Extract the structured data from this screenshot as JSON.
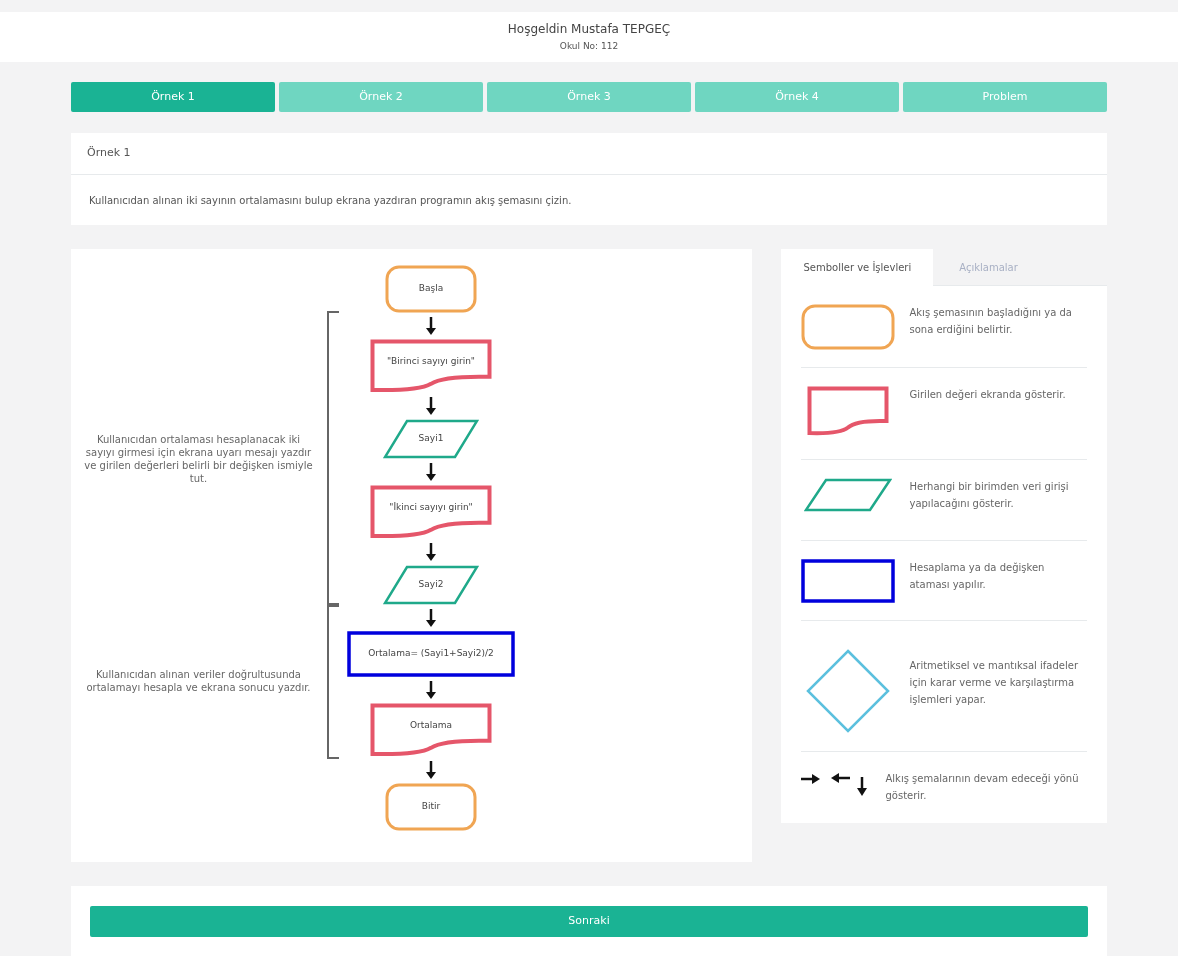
{
  "header": {
    "greeting": "Hoşgeldin Mustafa TEPGEÇ",
    "school_no": "Okul No: 112"
  },
  "tabs": [
    {
      "label": "Örnek 1",
      "selected": true
    },
    {
      "label": "Örnek 2",
      "selected": false
    },
    {
      "label": "Örnek 3",
      "selected": false
    },
    {
      "label": "Örnek 4",
      "selected": false
    },
    {
      "label": "Problem",
      "selected": false
    }
  ],
  "task": {
    "title": "Örnek 1",
    "text": "Kullanıcıdan alınan iki sayının ortalamasını bulup ekrana yazdıran programın akış şemasını çizin."
  },
  "flowchart": {
    "sections": [
      {
        "nodes": [
          {
            "kind": "terminal",
            "label": "Başla"
          }
        ]
      },
      {
        "note": "Kullanıcıdan ortalaması hesaplanacak iki sayıyı girmesi için ekrana uyarı mesajı yazdır ve girilen değerleri belirli bir değişken ismiyle tut.",
        "nodes": [
          {
            "kind": "display",
            "label": "\"Birinci sayıyı girin\""
          },
          {
            "kind": "input",
            "label": "Sayi1"
          },
          {
            "kind": "display",
            "label": "\"İkinci sayıyı girin\""
          },
          {
            "kind": "input",
            "label": "Sayi2"
          }
        ]
      },
      {
        "note": "Kullanıcıdan alınan veriler doğrultusunda ortalamayı hesapla ve ekrana sonucu yazdır.",
        "nodes": [
          {
            "kind": "process",
            "label": "Ortalama= (Sayi1+Sayi2)/2"
          },
          {
            "kind": "display",
            "label": "Ortalama"
          }
        ]
      },
      {
        "nodes": [
          {
            "kind": "terminal",
            "label": "Bitir"
          }
        ]
      }
    ]
  },
  "legend": {
    "tabs": [
      {
        "label": "Semboller ve İşlevleri",
        "selected": true
      },
      {
        "label": "Açıklamalar",
        "selected": false
      }
    ],
    "items": [
      {
        "kind": "terminal",
        "text": "Akış şemasının başladığını ya da sona erdiğini belirtir."
      },
      {
        "kind": "display",
        "text": "Girilen değeri ekranda gösterir."
      },
      {
        "kind": "input",
        "text": "Herhangi bir birimden veri girişi yapılacağını gösterir."
      },
      {
        "kind": "process",
        "text": "Hesaplama ya da değişken ataması yapılır."
      },
      {
        "kind": "decision",
        "text": "Aritmetiksel ve mantıksal ifadeler için karar verme ve karşılaştırma işlemleri yapar."
      },
      {
        "kind": "arrows",
        "text": "Alkış şemalarının devam edeceği yönü gösterir."
      }
    ]
  },
  "next_button": "Sonraki"
}
